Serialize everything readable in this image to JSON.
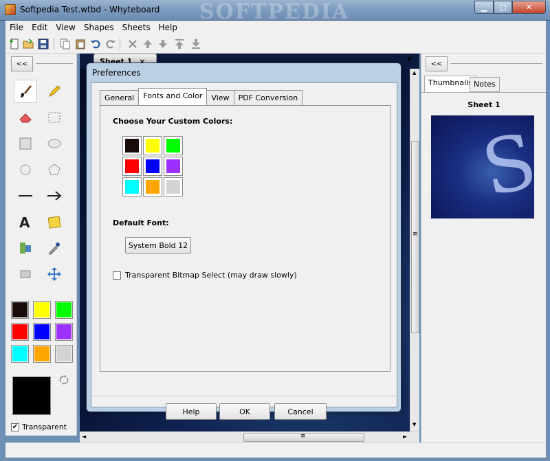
{
  "window": {
    "title": "Softpedia Test.wtbd - Whyteboard",
    "watermark": "SOFTPEDIA",
    "controls": {
      "minimize": "▁",
      "maximize": "□",
      "close": "✕"
    }
  },
  "menubar": [
    "File",
    "Edit",
    "View",
    "Shapes",
    "Sheets",
    "Help"
  ],
  "toolbar": {
    "icons": [
      "new-icon",
      "open-icon",
      "save-icon",
      "copy-icon",
      "paste-icon",
      "undo-icon",
      "redo-icon",
      "delete-icon",
      "move-up-icon",
      "move-down-icon",
      "move-top-icon",
      "move-bottom-icon"
    ]
  },
  "left_panel": {
    "collapse_label": "<<",
    "tools": [
      "brush-icon",
      "highlighter-icon",
      "eraser-icon",
      "select-rect-icon",
      "rectangle-icon",
      "ellipse-icon",
      "circle-icon",
      "polygon-icon",
      "line-icon",
      "arrow-icon",
      "text-icon",
      "note-icon",
      "media-icon",
      "eyedropper-icon",
      "image-select-icon",
      "move-icon"
    ],
    "palette": [
      "#1a0a0a",
      "#ffff00",
      "#00ff00",
      "#ff0000",
      "#0000ff",
      "#9b30ff",
      "#00ffff",
      "#ffa500",
      "#d3d3d3"
    ],
    "current_color": "#000000",
    "swap_icon": "swap-icon",
    "transparent_label": "Transparent",
    "transparent_checked": "✔"
  },
  "canvas": {
    "sheet_tab": "Sheet 1",
    "sheet_tab_close": "×",
    "tab_dropdown": "▼",
    "scroll_grip": "≡",
    "arrows": {
      "up": "▲",
      "down": "▼",
      "left": "◄",
      "right": "►"
    }
  },
  "right_panel": {
    "collapse_label": "<<",
    "tabs": [
      "Thumbnails",
      "Notes"
    ],
    "thumbnail_title": "Sheet 1"
  },
  "dialog": {
    "title": "Preferences",
    "tabs": [
      "General",
      "Fonts and Color",
      "View",
      "PDF Conversion"
    ],
    "active_tab": "Fonts and Color",
    "colors_label": "Choose Your Custom Colors:",
    "custom_colors": [
      "#1a0a0a",
      "#ffff00",
      "#00ff00",
      "#ff0000",
      "#0000ff",
      "#9b30ff",
      "#00ffff",
      "#ffa500",
      "#d3d3d3"
    ],
    "font_label": "Default Font:",
    "font_button": "System Bold  12",
    "transparent_select": "Transparent Bitmap Select (may draw slowly)",
    "buttons": {
      "help": "Help",
      "ok": "OK",
      "cancel": "Cancel"
    }
  }
}
